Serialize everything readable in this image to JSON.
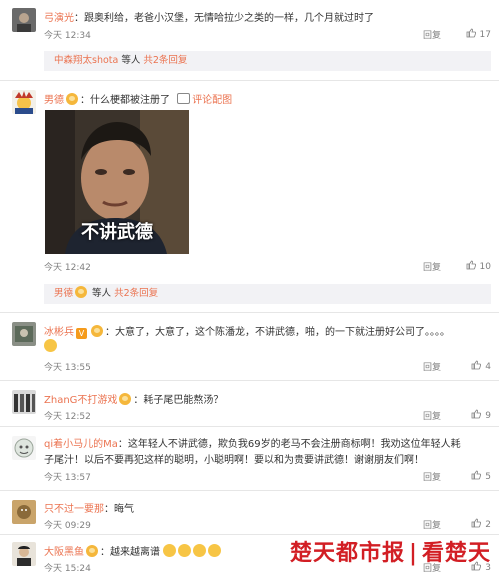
{
  "comments": [
    {
      "user": "弓演光",
      "text": "：跟奥利给，老爸小汉堡，无情哈拉少之类的一样，几个月就过时了",
      "time": "今天 12:34",
      "reply": "回复",
      "likes": "17",
      "replies": {
        "names": "中森翔太shota",
        "sep": " 等人 ",
        "more": "共2条回复"
      }
    },
    {
      "user": "男德",
      "text": "：什么梗都被注册了",
      "pic_link": "评论配图",
      "meme_caption": "不讲武德",
      "time": "今天 12:42",
      "reply": "回复",
      "likes": "10",
      "replies": {
        "names": "男德",
        "sep": " 等人 ",
        "more": "共2条回复"
      }
    },
    {
      "user": "冰彬兵",
      "vbadge": "V",
      "text": "：大意了，大意了，这个陈潘龙，不讲武德，啪，的一下就注册好公司了。。。。",
      "time": "今天 13:55",
      "reply": "回复",
      "likes": "4"
    },
    {
      "user": "ZhanG不打游戏",
      "text": "：耗子尾巴能熬汤？",
      "time": "今天 12:52",
      "reply": "回复",
      "likes": "9"
    },
    {
      "user": "qi着小马儿的Ma",
      "text": "：这年轻人不讲武德，欺负我69岁的老马不会注册商标啊！我劝这位年轻人耗",
      "text2": "子尾汁！以后不要再犯这样的聪明，小聪明啊！要以和为贵要讲武德！谢谢朋友们啊！",
      "time": "今天 13:57",
      "reply": "回复",
      "likes": "5"
    },
    {
      "user": "只不过一要那",
      "text": "：晦气",
      "time": "今天 09:29",
      "reply": "回复",
      "likes": "2"
    },
    {
      "user": "大阪黑鱼",
      "text": "：越来越离谱",
      "time": "今天 15:24",
      "reply": "回复",
      "likes": "3"
    }
  ],
  "watermark": {
    "left": "楚天都市报",
    "right": "看楚天"
  },
  "colors": {
    "username": "#eb7350",
    "meta": "#808080",
    "reply_bg": "#f2f2f5",
    "watermark": "#d21e24"
  }
}
